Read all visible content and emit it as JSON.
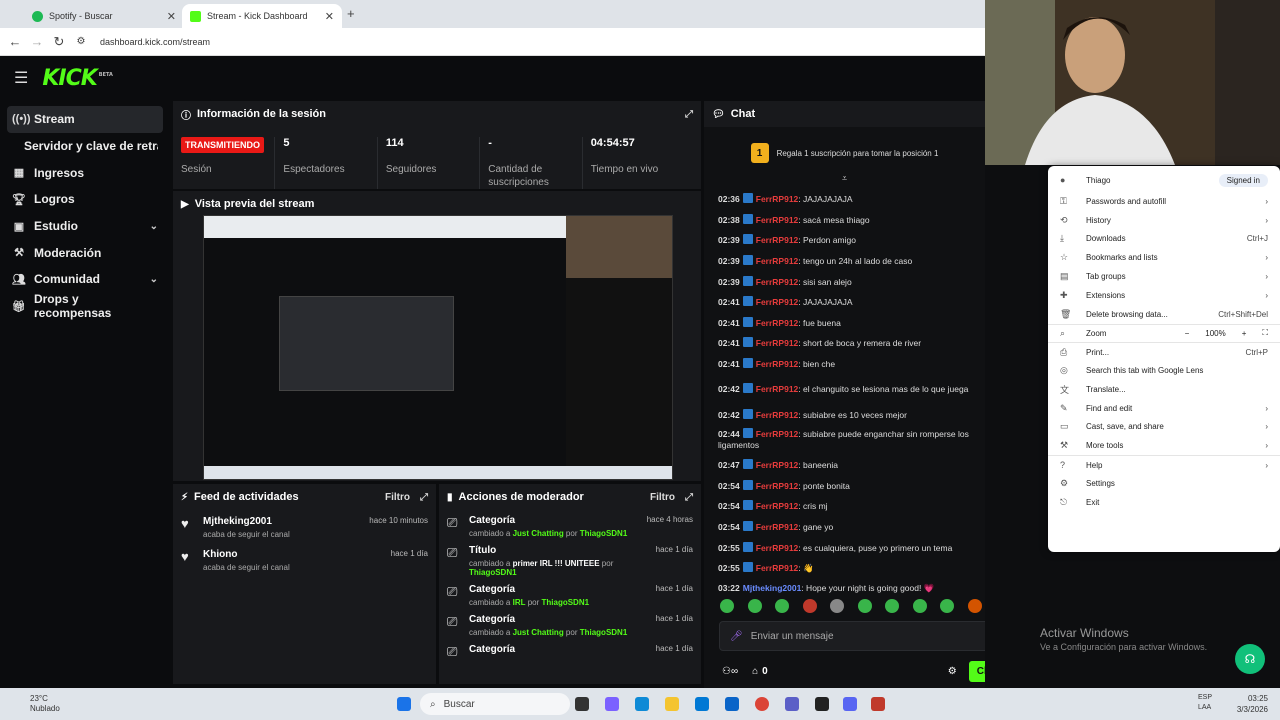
{
  "browser": {
    "tabs": [
      {
        "title": "Spotify - Buscar",
        "active": false,
        "color": "#1db954"
      },
      {
        "title": "Stream - Kick Dashboard",
        "active": true,
        "color": "#53fc18"
      }
    ],
    "new_tab": "+",
    "url": "dashboard.kick.com/stream"
  },
  "kick": {
    "logo": "KICK",
    "logo_tag": "BETA",
    "accent": "#53fc18"
  },
  "sidebar": {
    "items": [
      {
        "label": "Stream",
        "icon": "broadcast-icon",
        "active": true
      },
      {
        "label": "Servidor y clave de retransm",
        "sub": true
      },
      {
        "label": "Ingresos",
        "icon": "chart-icon"
      },
      {
        "label": "Logros",
        "icon": "trophy-icon"
      },
      {
        "label": "Estudio",
        "icon": "studio-icon",
        "chevron": true
      },
      {
        "label": "Moderación",
        "icon": "hammer-icon"
      },
      {
        "label": "Comunidad",
        "icon": "people-icon",
        "chevron": true
      },
      {
        "label": "Drops y recompensas",
        "icon": "gift-icon"
      }
    ]
  },
  "session": {
    "title": "Información de la sesión",
    "live_badge": "TRANSMITIENDO",
    "stats": [
      {
        "value": "",
        "label": "Sesión"
      },
      {
        "value": "5",
        "label": "Espectadores"
      },
      {
        "value": "114",
        "label": "Seguidores"
      },
      {
        "value": "-",
        "label": "Cantidad de suscripciones"
      },
      {
        "value": "04:54:57",
        "label": "Tiempo en vivo"
      }
    ]
  },
  "preview": {
    "title": "Vista previa del stream"
  },
  "feed": {
    "title": "Feed de actividades",
    "filter": "Filtro",
    "items": [
      {
        "name": "Mjtheking2001",
        "sub": "acaba de seguir el canal",
        "time": "hace 10 minutos"
      },
      {
        "name": "Khiono",
        "sub": "acaba de seguir el canal",
        "time": "hace 1 día"
      }
    ]
  },
  "mod": {
    "title": "Acciones de moderador",
    "filter": "Filtro",
    "items": [
      {
        "title": "Categoría",
        "pre": "cambiado a ",
        "value": "Just Chatting",
        "by": " por ",
        "user": "ThiagoSDN1",
        "time": "hace 4 horas"
      },
      {
        "title": "Título",
        "pre": "cambiado a ",
        "value": "primer IRL !!! UNITEEE",
        "by": " por ",
        "user": "ThiagoSDN1",
        "time": "hace 1 día"
      },
      {
        "title": "Categoría",
        "pre": "cambiado a ",
        "value": "IRL",
        "by": " por ",
        "user": "ThiagoSDN1",
        "time": "hace 1 día"
      },
      {
        "title": "Categoría",
        "pre": "cambiado a ",
        "value": "Just Chatting",
        "by": " por ",
        "user": "ThiagoSDN1",
        "time": "hace 1 día"
      },
      {
        "title": "Categoría",
        "pre": "",
        "value": "",
        "by": "",
        "user": "",
        "time": "hace 1 día"
      }
    ]
  },
  "chat": {
    "title": "Chat",
    "promo_num": "1",
    "promo": "Regala 1 suscripción para tomar la posición 1",
    "messages": [
      {
        "time": "02:36",
        "user": "FerrRP912",
        "text": ": JAJAJAJAJA"
      },
      {
        "time": "02:38",
        "user": "FerrRP912",
        "text": ": sacá mesa thiago"
      },
      {
        "time": "02:39",
        "user": "FerrRP912",
        "text": ": Perdon amigo"
      },
      {
        "time": "02:39",
        "user": "FerrRP912",
        "text": ": tengo un 24h al lado de caso"
      },
      {
        "time": "02:39",
        "user": "FerrRP912",
        "text": ": sisi san alejo"
      },
      {
        "time": "02:41",
        "user": "FerrRP912",
        "text": ": JAJAJAJAJA"
      },
      {
        "time": "02:41",
        "user": "FerrRP912",
        "text": ": fue buena"
      },
      {
        "time": "02:41",
        "user": "FerrRP912",
        "text": ": short de boca y remera de river"
      },
      {
        "time": "02:41",
        "user": "FerrRP912",
        "text": ": bien che"
      },
      {
        "time": "02:42",
        "user": "FerrRP912",
        "text": ": el changuito se lesiona mas de lo que juega"
      },
      {
        "time": "02:42",
        "user": "FerrRP912",
        "text": ": subiabre es 10 veces mejor"
      },
      {
        "time": "02:44",
        "user": "FerrRP912",
        "text": ": subiabre puede enganchar sin romperse los ligamentos"
      },
      {
        "time": "02:47",
        "user": "FerrRP912",
        "text": ": baneenia"
      },
      {
        "time": "02:54",
        "user": "FerrRP912",
        "text": ": ponte bonita"
      },
      {
        "time": "02:54",
        "user": "FerrRP912",
        "text": ": cris mj"
      },
      {
        "time": "02:54",
        "user": "FerrRP912",
        "text": ": gane yo"
      },
      {
        "time": "02:55",
        "user": "FerrRP912",
        "text": ": es cualquiera, puse yo primero un tema"
      },
      {
        "time": "02:55",
        "user": "FerrRP912",
        "text": ": 👋"
      },
      {
        "time": "03:22",
        "user": "Mjtheking2001",
        "text": ": Hope your night is going good! 💗"
      }
    ],
    "input_placeholder": "Enviar un mensaje",
    "count": "0",
    "send": "Chat"
  },
  "context_menu": {
    "items": [
      {
        "label": "Thiago",
        "right": "Signed in",
        "icon": "profile-icon"
      },
      {
        "label": "Passwords and autofill",
        "right": "›",
        "icon": "key-icon"
      },
      {
        "label": "History",
        "right": "›",
        "icon": "history-icon"
      },
      {
        "label": "Downloads",
        "right": "Ctrl+J",
        "icon": "download-icon"
      },
      {
        "label": "Bookmarks and lists",
        "right": "›",
        "icon": "star-icon"
      },
      {
        "label": "Tab groups",
        "right": "›",
        "icon": "tabgroups-icon"
      },
      {
        "label": "Extensions",
        "right": "›",
        "icon": "puzzle-icon"
      },
      {
        "label": "Delete browsing data...",
        "right": "Ctrl+Shift+Del",
        "icon": "trash-icon"
      },
      {
        "label": "Zoom",
        "right": "100%",
        "icon": "zoom-icon",
        "sep": true
      },
      {
        "label": "Print...",
        "right": "Ctrl+P",
        "icon": "print-icon",
        "sep": true
      },
      {
        "label": "Search this tab with Google Lens",
        "right": "",
        "icon": "lens-icon"
      },
      {
        "label": "Translate...",
        "right": "",
        "icon": "translate-icon"
      },
      {
        "label": "Find and edit",
        "right": "›",
        "icon": "find-icon"
      },
      {
        "label": "Cast, save, and share",
        "right": "›",
        "icon": "cast-icon"
      },
      {
        "label": "More tools",
        "right": "›",
        "icon": "tools-icon"
      },
      {
        "label": "Help",
        "right": "›",
        "icon": "help-icon",
        "sep": true
      },
      {
        "label": "Settings",
        "right": "",
        "icon": "settings-icon"
      },
      {
        "label": "Exit",
        "right": "",
        "icon": "exit-icon"
      }
    ]
  },
  "windows": {
    "activate_title": "Activar Windows",
    "activate_sub": "Ve a Configuración para activar Windows."
  },
  "taskbar": {
    "weather_temp": "23°C",
    "weather_desc": "Nublado",
    "search": "Buscar",
    "lang1": "ESP",
    "lang2": "LAA",
    "time": "03:25",
    "date": "3/3/2026"
  }
}
